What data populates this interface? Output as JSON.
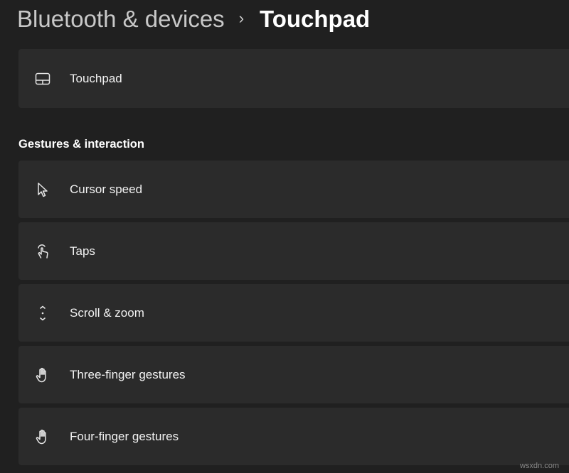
{
  "breadcrumb": {
    "parent": "Bluetooth & devices",
    "separator": "›",
    "current": "Touchpad"
  },
  "top_card": {
    "label": "Touchpad",
    "icon": "touchpad-icon"
  },
  "section": {
    "title": "Gestures & interaction"
  },
  "items": [
    {
      "label": "Cursor speed",
      "icon": "cursor-icon"
    },
    {
      "label": "Taps",
      "icon": "tap-icon"
    },
    {
      "label": "Scroll & zoom",
      "icon": "scroll-icon"
    },
    {
      "label": "Three-finger gestures",
      "icon": "hand-icon"
    },
    {
      "label": "Four-finger gestures",
      "icon": "hand-icon"
    }
  ],
  "watermark": "wsxdn.com",
  "colors": {
    "background": "#202020",
    "card": "#2b2b2b",
    "text": "#ffffff",
    "muted": "#c8c8c8"
  }
}
